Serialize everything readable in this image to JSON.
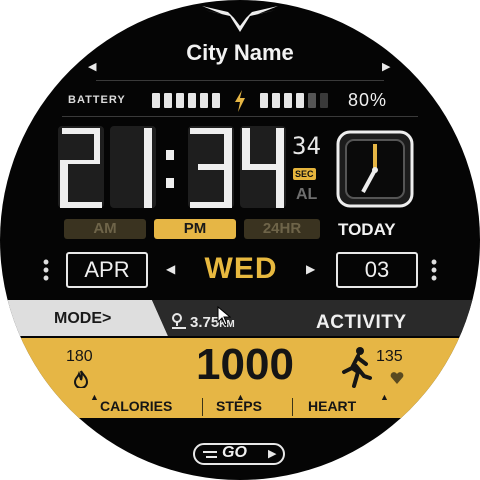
{
  "header": {
    "logo_icon": "winged-emblem-icon",
    "city": "City Name"
  },
  "battery": {
    "label": "BATTERY",
    "percent_text": "80%",
    "level": 0.8,
    "icon": "lightning-icon"
  },
  "time": {
    "hours_minutes": "21:34",
    "seconds": "34",
    "seconds_label": "SEC",
    "alarm_label": "AL"
  },
  "mode_pills": [
    {
      "label": "AM",
      "active": false
    },
    {
      "label": "PM",
      "active": true
    },
    {
      "label": "24HR",
      "active": false
    }
  ],
  "today_label": "TODAY",
  "date": {
    "month": "APR",
    "weekday": "WED",
    "day": "03"
  },
  "activity": {
    "mode_label": "MODE>",
    "distance_value": "3.75",
    "distance_unit": "KM",
    "title": "ACTIVITY",
    "calories_value": "180",
    "steps_value": "1000",
    "heart_value": "135",
    "calories_label": "CALORIES",
    "steps_label": "STEPS",
    "heart_label": "HEART"
  },
  "go_label": "GO",
  "colors": {
    "accent": "#e6b645",
    "background": "#050505",
    "text": "#f0f0f0",
    "dim": "#3a3320"
  }
}
